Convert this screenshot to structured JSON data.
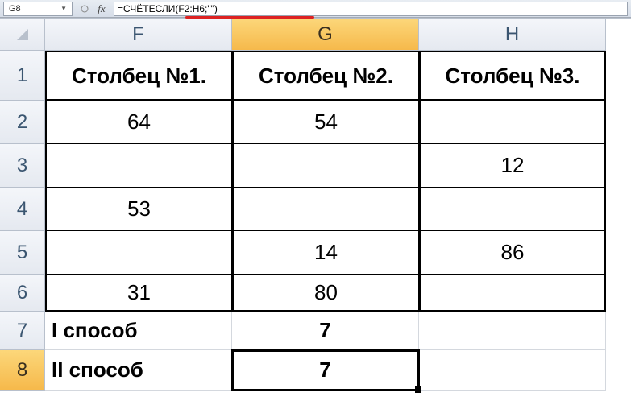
{
  "nameBox": "G8",
  "formula": "=СЧЁТЕСЛИ(F2:H6;\"\")",
  "fxLabel": "fx",
  "columns": [
    "F",
    "G",
    "H"
  ],
  "rows": [
    "1",
    "2",
    "3",
    "4",
    "5",
    "6",
    "7",
    "8"
  ],
  "activeCol": "G",
  "activeRow": "8",
  "cells": {
    "F1": "Столбец №1.",
    "G1": "Столбец №2.",
    "H1": "Столбец №3.",
    "F2": "64",
    "G2": "54",
    "H2": "",
    "F3": "",
    "G3": "",
    "H3": "12",
    "F4": "53",
    "G4": "",
    "H4": "",
    "F5": "",
    "G5": "14",
    "H5": "86",
    "F6": "31",
    "G6": "80",
    "H6": "",
    "F7": "I способ",
    "G7": "7",
    "H7": "",
    "F8": "II способ",
    "G8": "7",
    "H8": ""
  },
  "chart_data": {
    "type": "table",
    "title": "",
    "columns": [
      "Столбец №1.",
      "Столбец №2.",
      "Столбец №3."
    ],
    "rows": [
      [
        64,
        54,
        null
      ],
      [
        null,
        null,
        12
      ],
      [
        53,
        null,
        null
      ],
      [
        null,
        14,
        86
      ],
      [
        31,
        80,
        null
      ]
    ],
    "summary": [
      {
        "label": "I способ",
        "value": 7
      },
      {
        "label": "II способ",
        "value": 7
      }
    ],
    "formula_shown": "=СЧЁТЕСЛИ(F2:H6;\"\")"
  }
}
